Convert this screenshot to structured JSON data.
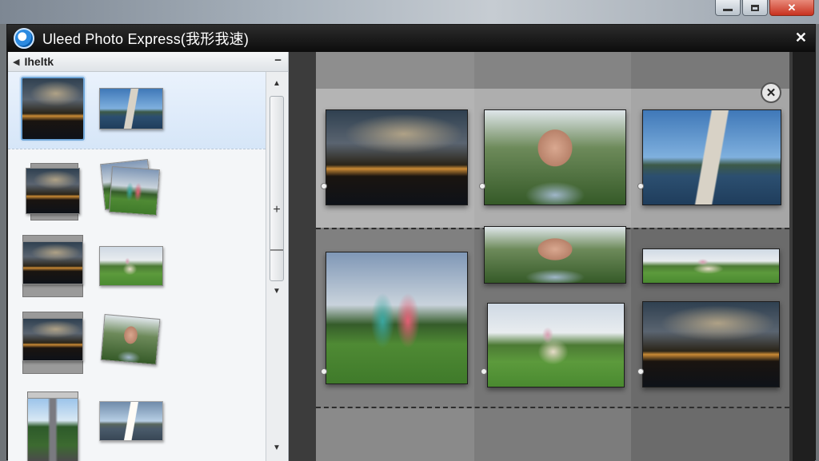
{
  "window": {
    "title": "Uleed Photo Express(我形我速)",
    "close_glyph": "✕",
    "controls": {
      "minimize_icon": "minimize-icon",
      "maximize_icon": "maximize-icon",
      "close_glyph": "✕"
    }
  },
  "left_panel": {
    "header_arrow": "◀",
    "header_label": "Ihelt​k",
    "collapse_glyph": "−",
    "rows": [
      {
        "left": "night-cityscape",
        "right": "bridge-sunset",
        "selected": true
      },
      {
        "left": "night-cityscape",
        "right": "kids-in-park"
      },
      {
        "left": "night-cityscape",
        "right": "child-with-dog"
      },
      {
        "left": "night-cityscape",
        "right": "girl-portrait"
      },
      {
        "left": "tree-lined-road",
        "right": "bridge-cloudy"
      }
    ],
    "scrollbar": {
      "up": "▲",
      "down": "▼",
      "zoom_in": "+",
      "zoom_out": "—"
    }
  },
  "preview": {
    "close_glyph": "✕",
    "photos": [
      "night-cityscape",
      "girl-portrait",
      "bridge-pylon",
      "kids-in-park",
      "girl-portrait",
      "child-with-dog",
      "child-with-dog-pano",
      "night-cityscape"
    ]
  },
  "colors": {
    "accent_blue": "#2c8ae0",
    "selection": "#d6e6f8",
    "titlebar": "#0c0c0c"
  }
}
